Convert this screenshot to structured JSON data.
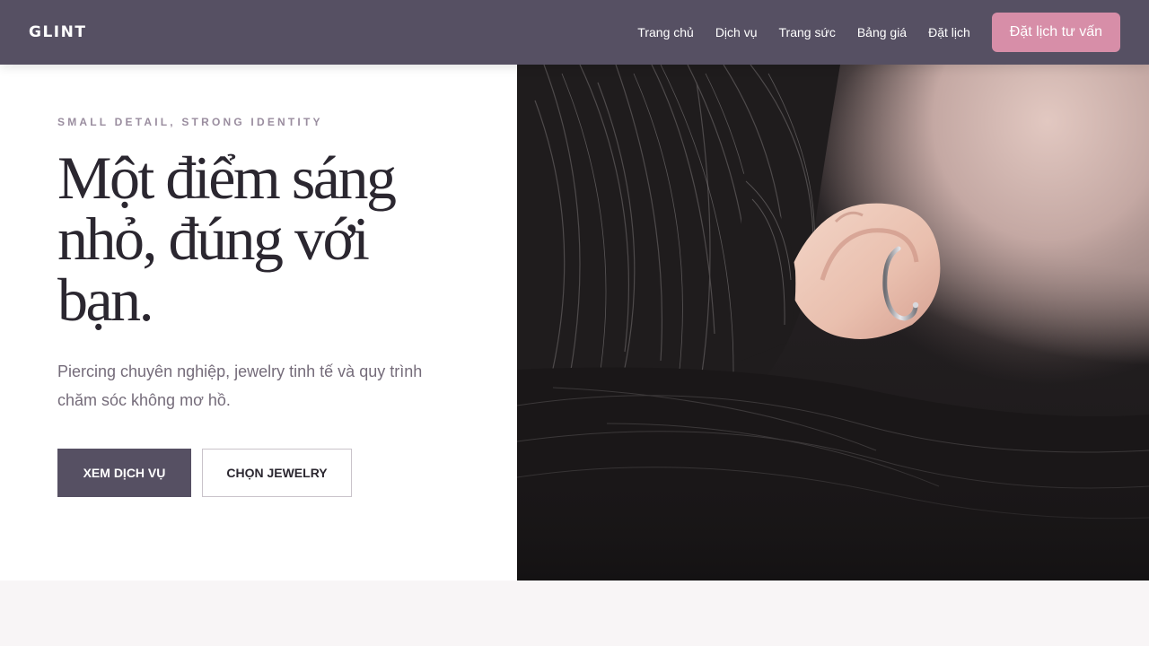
{
  "brand": {
    "name": "GLINT"
  },
  "nav": {
    "links": [
      {
        "label": "Trang chủ"
      },
      {
        "label": "Dịch vụ"
      },
      {
        "label": "Trang sức"
      },
      {
        "label": "Bảng giá"
      },
      {
        "label": "Đặt lịch"
      }
    ],
    "cta_label": "Đặt lịch tư vấn"
  },
  "hero": {
    "eyebrow": "SMALL DETAIL, STRONG IDENTITY",
    "headline": "Một điểm sáng nhỏ, đúng với bạn.",
    "lede": "Piercing chuyên nghiệp, jewelry tinh tế và quy trình chăm sóc không mơ hồ.",
    "primary_button": "XEM DỊCH VỤ",
    "secondary_button": "CHỌN JEWELRY",
    "image_icon": "ear-piercing-photo"
  },
  "colors": {
    "header_bg": "#565063",
    "accent_pink": "#d78ea8",
    "primary_button_bg": "#565063",
    "eyebrow": "#9a8d9f",
    "headline": "#2b2730",
    "body_text": "#756c7a",
    "page_bg": "#f8f5f6"
  }
}
